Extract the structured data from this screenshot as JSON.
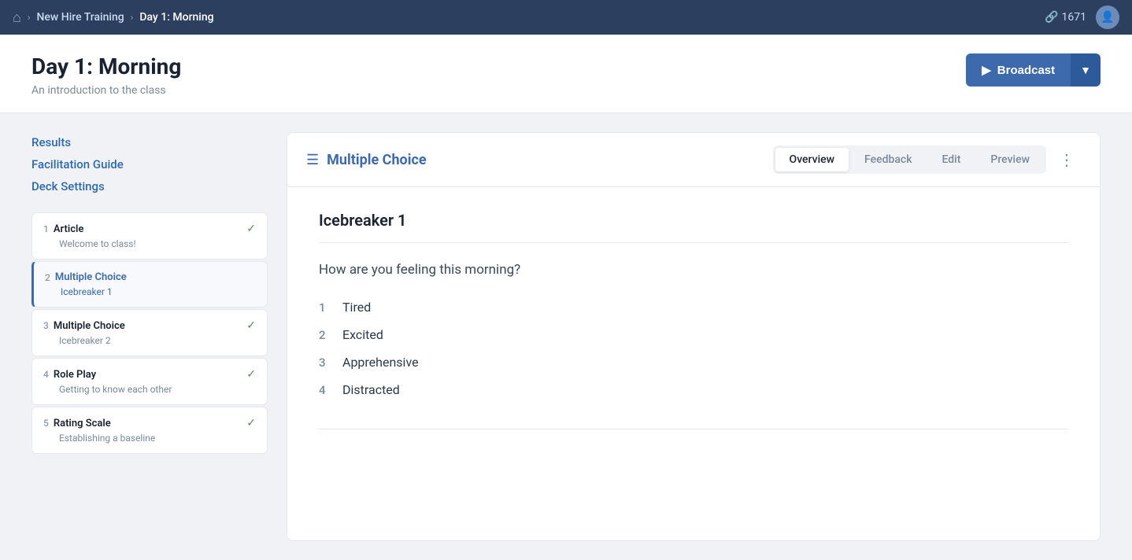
{
  "topnav": {
    "home_icon": "🏠",
    "chevron": "›",
    "breadcrumb_parent": "New Hire Training",
    "breadcrumb_current": "Day 1: Morning",
    "session_id": "1671",
    "link_icon": "🔗"
  },
  "page_header": {
    "title": "Day 1: Morning",
    "subtitle": "An introduction to the class",
    "broadcast_label": "Broadcast",
    "broadcast_arrow": "▼"
  },
  "sidebar": {
    "nav_items": [
      {
        "label": "Results"
      },
      {
        "label": "Facilitation Guide"
      },
      {
        "label": "Deck Settings"
      }
    ],
    "list_items": [
      {
        "number": "1",
        "type": "Article",
        "subtitle": "Welcome to class!",
        "checked": true,
        "active": false
      },
      {
        "number": "2",
        "type": "Multiple Choice",
        "subtitle": "Icebreaker 1",
        "checked": false,
        "active": true
      },
      {
        "number": "3",
        "type": "Multiple Choice",
        "subtitle": "Icebreaker 2",
        "checked": true,
        "active": false
      },
      {
        "number": "4",
        "type": "Role Play",
        "subtitle": "Getting to know each other",
        "checked": true,
        "active": false
      },
      {
        "number": "5",
        "type": "Rating Scale",
        "subtitle": "Establishing a baseline",
        "checked": true,
        "active": false
      }
    ]
  },
  "content": {
    "icon": "☰",
    "title": "Multiple Choice",
    "tabs": [
      {
        "label": "Overview",
        "active": true
      },
      {
        "label": "Feedback",
        "active": false
      },
      {
        "label": "Edit",
        "active": false
      },
      {
        "label": "Preview",
        "active": false
      }
    ],
    "section_title": "Icebreaker 1",
    "question": "How are you feeling this morning?",
    "answers": [
      {
        "number": "1",
        "text": "Tired"
      },
      {
        "number": "2",
        "text": "Excited"
      },
      {
        "number": "3",
        "text": "Apprehensive"
      },
      {
        "number": "4",
        "text": "Distracted"
      }
    ]
  }
}
